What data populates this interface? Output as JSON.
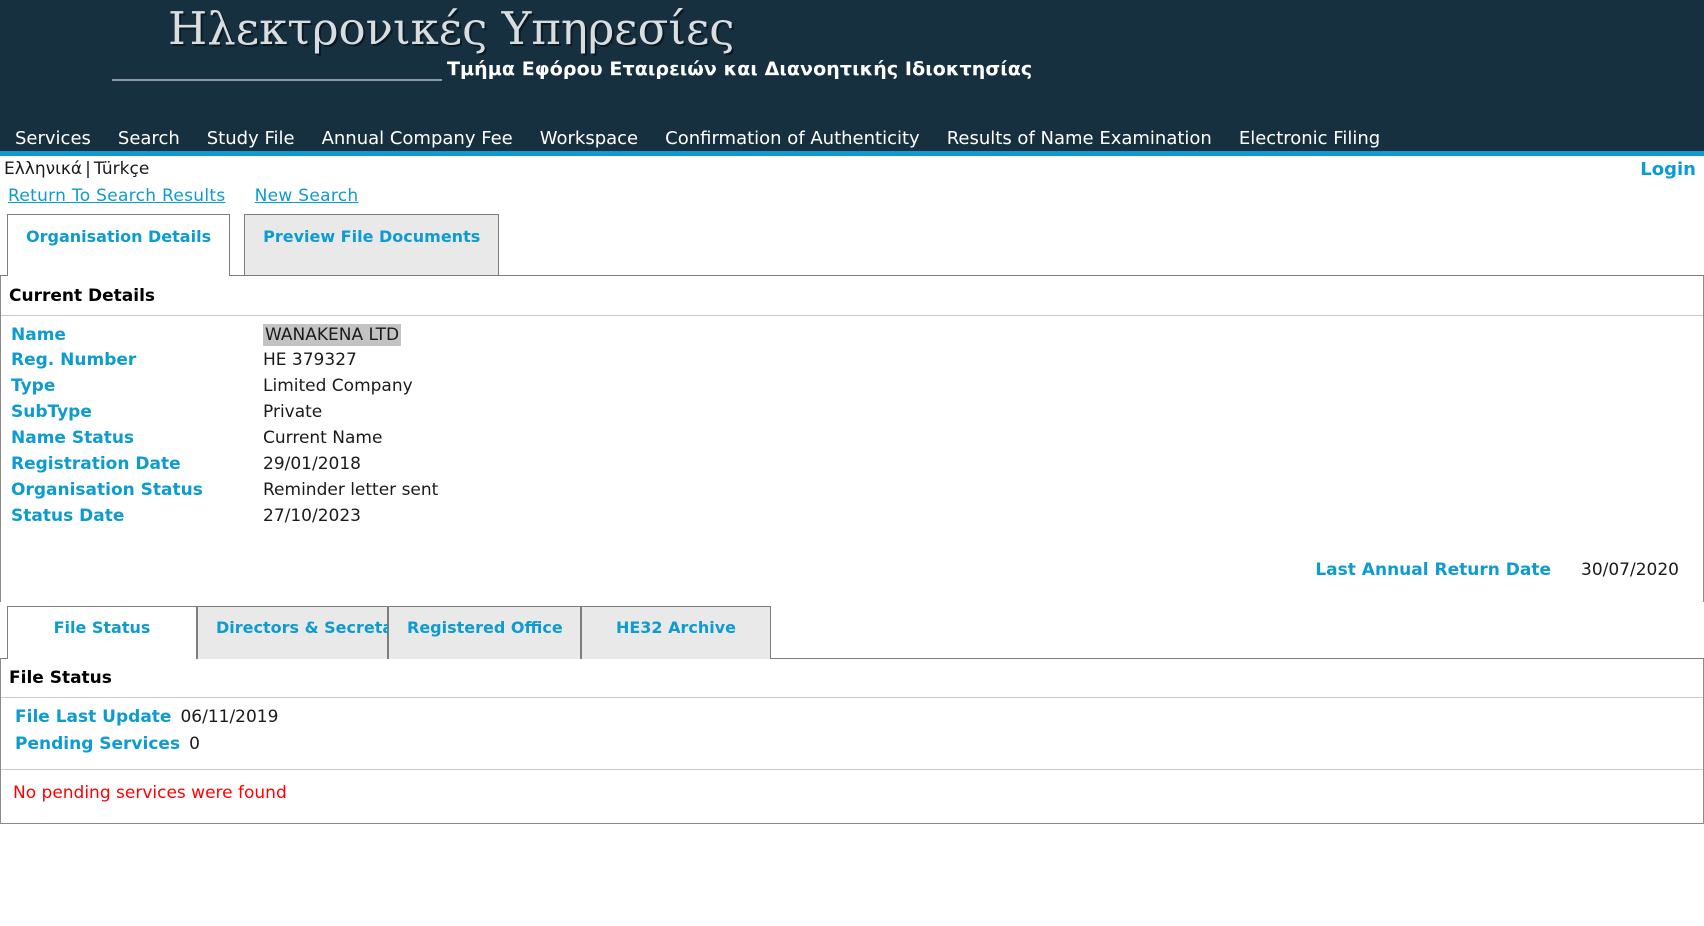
{
  "header": {
    "title": "Ηλεκτρονικές Υπηρεσίες",
    "subtitle": "Τμήμα Εφόρου Εταιρειών και Διανοητικής Ιδιοκτησίας",
    "accent_color": "#0d9bd0",
    "background_color": "#16303f"
  },
  "nav": {
    "items": [
      {
        "label": "Services"
      },
      {
        "label": "Search"
      },
      {
        "label": "Study File"
      },
      {
        "label": "Annual Company Fee"
      },
      {
        "label": "Workspace"
      },
      {
        "label": "Confirmation of Authenticity"
      },
      {
        "label": "Results of Name Examination"
      },
      {
        "label": "Electronic Filing"
      }
    ]
  },
  "lang_bar": {
    "greek": "Ελληνικά",
    "separator": "|",
    "turkish": "Türkçe",
    "login": "Login"
  },
  "actions": {
    "return_to_search": "Return To Search Results",
    "new_search": "New Search"
  },
  "top_tabs": [
    {
      "label": "Organisation Details",
      "active": true
    },
    {
      "label": "Preview File Documents",
      "active": false
    }
  ],
  "current_details": {
    "section_title": "Current Details",
    "rows": [
      {
        "label": "Name",
        "value": "WANAKENA LTD",
        "highlighted": true
      },
      {
        "label": "Reg. Number",
        "value": "HE 379327",
        "highlighted": false
      },
      {
        "label": "Type",
        "value": "Limited Company",
        "highlighted": false
      },
      {
        "label": "SubType",
        "value": "Private",
        "highlighted": false
      },
      {
        "label": "Name Status",
        "value": "Current Name",
        "highlighted": false
      },
      {
        "label": "Registration Date",
        "value": "29/01/2018",
        "highlighted": false
      },
      {
        "label": "Organisation Status",
        "value": "Reminder letter sent",
        "highlighted": false
      },
      {
        "label": "Status Date",
        "value": "27/10/2023",
        "highlighted": false
      }
    ],
    "annual_return_label": "Last Annual Return Date",
    "annual_return_value": "30/07/2020"
  },
  "sub_tabs": [
    {
      "label": "File Status",
      "active": true
    },
    {
      "label": "Directors & Secretaries",
      "active": false
    },
    {
      "label": "Registered Office",
      "active": false
    },
    {
      "label": "HE32 Archive",
      "active": false
    }
  ],
  "file_status": {
    "section_title": "File Status",
    "last_update_label": "File Last Update",
    "last_update_value": "06/11/2019",
    "pending_label": "Pending Services",
    "pending_value": "0",
    "message": "No pending services were found",
    "message_color": "#ff0000"
  }
}
